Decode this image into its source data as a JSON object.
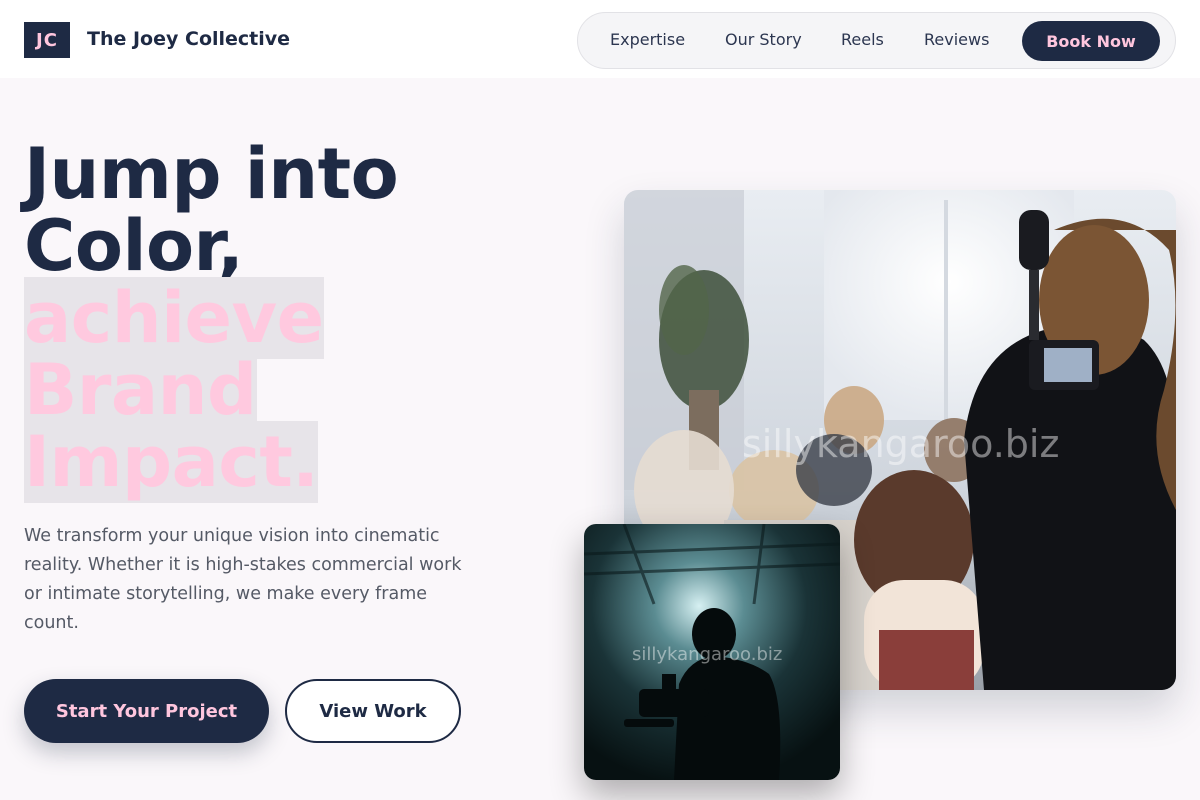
{
  "brand": {
    "initials": "JC",
    "name": "The Joey Collective"
  },
  "nav": {
    "items": [
      {
        "label": "Expertise"
      },
      {
        "label": "Our Story"
      },
      {
        "label": "Reels"
      },
      {
        "label": "Reviews"
      }
    ],
    "cta_label": "Book Now"
  },
  "hero": {
    "line1": "Jump into",
    "line2": "Color,",
    "line3": "achieve",
    "line4": "Brand",
    "line5": "Impact.",
    "description": "We transform your unique vision into cinematic reality. Whether it is high-stakes commercial work or intimate storytelling, we make every frame count.",
    "primary_cta": "Start Your Project",
    "secondary_cta": "View Work"
  },
  "media": {
    "main_watermark": "sillykangaroo.biz",
    "small_watermark": "sillykangaroo.biz",
    "main_icon": "videographer-filming-audience-photo",
    "small_icon": "silhouette-camera-operator-photo"
  },
  "colors": {
    "navy": "#1e2a44",
    "pink": "#ffc6de",
    "background": "#faf7fa"
  }
}
